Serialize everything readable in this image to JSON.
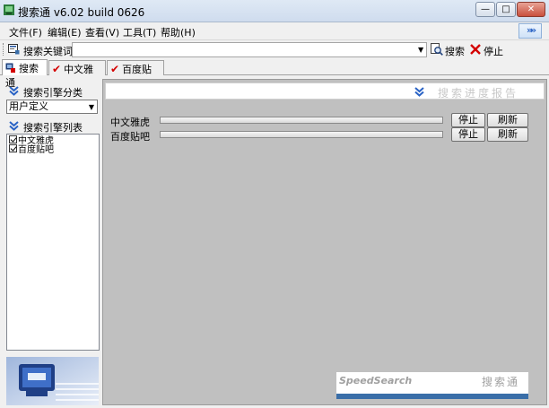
{
  "window": {
    "title": "搜索通 v6.02 build 0626",
    "controls": {
      "minimize": "—",
      "maximize": "□",
      "close": "✕"
    }
  },
  "menu": {
    "items": [
      "文件(F)",
      "编辑(E)",
      "查看(V)",
      "工具(T)",
      "帮助(H)"
    ],
    "overflow": "»»"
  },
  "search": {
    "keyword_label": "搜索关键词",
    "keyword_value": "",
    "search_button": "搜索",
    "stop_button": "停止"
  },
  "tabs": [
    {
      "label": "搜索通",
      "active": true,
      "icon": "app-icon"
    },
    {
      "label": "中文雅虎",
      "active": false,
      "icon": "red-check-icon"
    },
    {
      "label": "百度贴吧",
      "active": false,
      "icon": "red-check-icon"
    }
  ],
  "sidebar": {
    "category_title": "搜索引擎分类",
    "category_selected": "用户定义",
    "list_title": "搜索引擎列表",
    "engines": [
      {
        "label": "中文雅虎",
        "checked": true
      },
      {
        "label": "百度贴吧",
        "checked": true
      }
    ]
  },
  "report": {
    "title": "搜索进度报告",
    "rows": [
      {
        "name": "中文雅虎",
        "progress": 0,
        "stop": "停止",
        "refresh": "刷新"
      },
      {
        "name": "百度贴吧",
        "progress": 0,
        "stop": "停止",
        "refresh": "刷新"
      }
    ]
  },
  "brand": {
    "en": "SpeedSearch",
    "zh": "搜索通"
  },
  "colors": {
    "accent_blue": "#2a63c5",
    "check_red": "#d40000",
    "report_bg": "#c0c0c0"
  }
}
